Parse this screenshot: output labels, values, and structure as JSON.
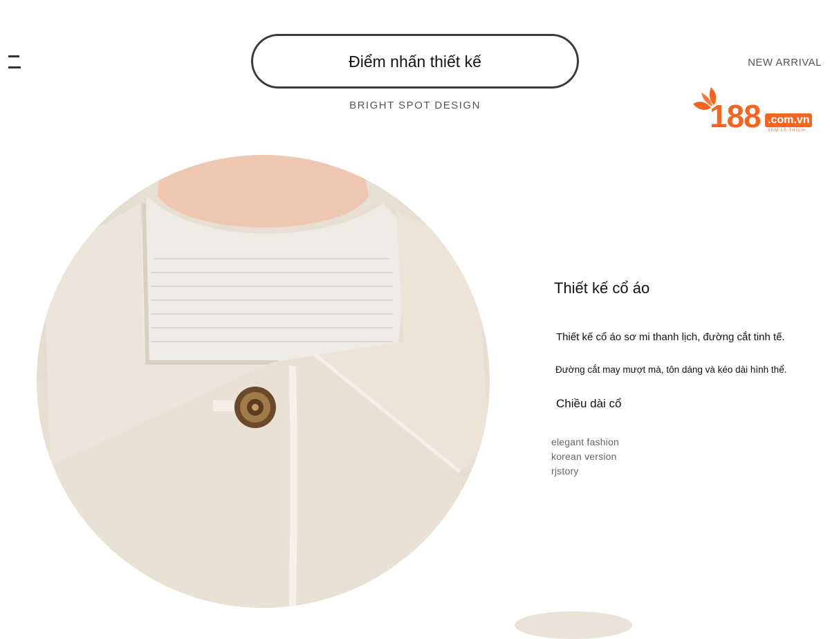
{
  "header": {
    "title": "Điểm nhấn thiết kế",
    "subtitle": "BRIGHT SPOT DESIGN",
    "new_arrival": "NEW ARRIVAL"
  },
  "logo": {
    "number": "188",
    "domain": ".com.vn",
    "tagline": "XEM LÀ THÍCH",
    "color": "#f26522"
  },
  "feature": {
    "heading": "Thiết kế cổ áo",
    "description_1": "Thiết kế cổ áo sơ mi thanh lịch, đường cắt tinh tế.",
    "description_2": "Đường cắt may mượt mà, tôn dáng và kéo dài hình thể.",
    "collar_length": "Chiều dài cổ",
    "english_lines": [
      "elegant fashion",
      "korean version",
      "rjstory"
    ]
  },
  "colors": {
    "coat": "#e8e1d4",
    "sweater": "#eeebe6",
    "skin": "#efc6b2",
    "button": "#6a4a2a"
  }
}
